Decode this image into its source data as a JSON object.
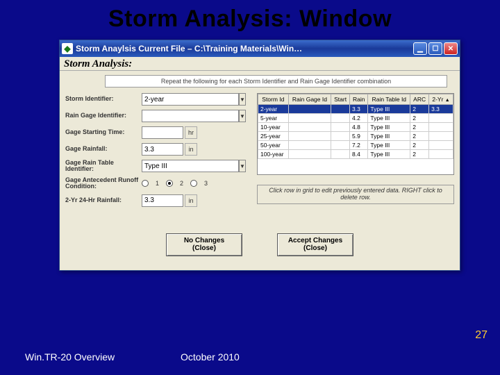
{
  "slide": {
    "title": "Storm Analysis: Window"
  },
  "window": {
    "title": "Storm Anaylsis   Current File – C:\\Training Materials\\Win…",
    "subheader": "Storm Analysis:",
    "banner": "Repeat the following for each Storm Identifier and Rain Gage Identifier combination"
  },
  "form": {
    "storm_identifier_label": "Storm Identifier:",
    "storm_identifier_value": "2-year",
    "rain_gage_label": "Rain Gage Identifier:",
    "rain_gage_value": "",
    "gage_start_label": "Gage Starting Time:",
    "gage_start_value": "",
    "gage_start_unit": "hr",
    "gage_rainfall_label": "Gage Rainfall:",
    "gage_rainfall_value": "3.3",
    "gage_rainfall_unit": "in",
    "rain_table_label": "Gage Rain Table Identifier:",
    "rain_table_value": "Type III",
    "arc_label": "Gage Antecedent Runoff Condition:",
    "arc_options": [
      "1",
      "2",
      "3"
    ],
    "arc_selected": "2",
    "two_yr_label": "2-Yr 24-Hr Rainfall:",
    "two_yr_value": "3.3",
    "two_yr_unit": "in"
  },
  "grid": {
    "headers": [
      "Storm Id",
      "Rain Gage Id",
      "Start",
      "Rain",
      "Rain Table Id",
      "ARC",
      "2-Yr"
    ],
    "rows": [
      {
        "storm": "2-year",
        "gage": "",
        "start": "",
        "rain": "3.3",
        "table": "Type III",
        "arc": "2",
        "yr2": "3.3",
        "hl": true
      },
      {
        "storm": "5-year",
        "gage": "",
        "start": "",
        "rain": "4.2",
        "table": "Type III",
        "arc": "2",
        "yr2": ""
      },
      {
        "storm": "10-year",
        "gage": "",
        "start": "",
        "rain": "4.8",
        "table": "Type III",
        "arc": "2",
        "yr2": ""
      },
      {
        "storm": "25-year",
        "gage": "",
        "start": "",
        "rain": "5.9",
        "table": "Type III",
        "arc": "2",
        "yr2": ""
      },
      {
        "storm": "50-year",
        "gage": "",
        "start": "",
        "rain": "7.2",
        "table": "Type III",
        "arc": "2",
        "yr2": ""
      },
      {
        "storm": "100-year",
        "gage": "",
        "start": "",
        "rain": "8.4",
        "table": "Type III",
        "arc": "2",
        "yr2": ""
      }
    ],
    "note": "Click row in grid to edit previously entered data.  RIGHT click to delete row."
  },
  "buttons": {
    "no_changes_l1": "No Changes",
    "no_changes_l2": "(Close)",
    "accept_l1": "Accept Changes",
    "accept_l2": "(Close)"
  },
  "footer": {
    "left": "Win.TR-20 Overview",
    "mid": "October 2010",
    "page": "27"
  }
}
